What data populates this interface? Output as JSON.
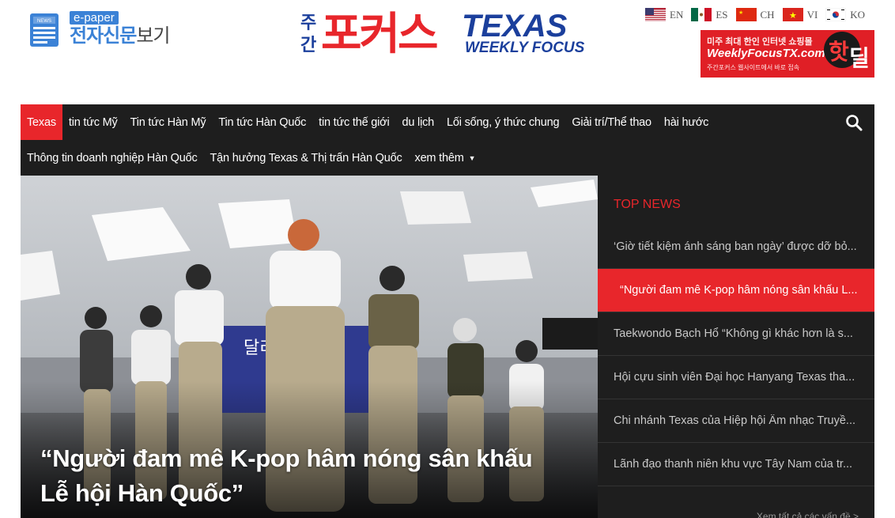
{
  "header": {
    "epaper_tag": "e-paper",
    "epaper_title_bold": "전자신문",
    "epaper_title_thin": "보기",
    "epaper_icon_label": "NEWS",
    "logo": {
      "korean_top": "주",
      "korean_bottom": "간",
      "korean_big": "포커스",
      "english_big": "TEXAS",
      "english_small": "WEEKLY FOCUS"
    },
    "languages": [
      {
        "code": "EN",
        "flag": "us-flag-icon"
      },
      {
        "code": "ES",
        "flag": "mx-flag-icon"
      },
      {
        "code": "CH",
        "flag": "cn-flag-icon"
      },
      {
        "code": "VI",
        "flag": "vn-flag-icon"
      },
      {
        "code": "KO",
        "flag": "kr-flag-icon"
      }
    ],
    "ad": {
      "line1": "미주 최대 한인 인터넷 쇼핑몰",
      "line2": "WeeklyFocusTX.com",
      "line3": "주간포커스 웹사이트에서 바로 접속",
      "badge_red": "핫",
      "badge_white": "딜"
    }
  },
  "nav": {
    "row1": [
      "Texas",
      "tin tức Mỹ",
      "Tin tức Hàn Mỹ",
      "Tin tức Hàn Quốc",
      "tin tức thế giới",
      "du lịch",
      "Lối sống, ý thức chung",
      "Giải trí/Thể thao",
      "hài hước"
    ],
    "row2": [
      "Thông tin doanh nghiệp Hàn Quốc",
      "Tận hưởng Texas & Thị trấn Hàn Quốc",
      "xem thêm"
    ],
    "active": "Texas"
  },
  "hero": {
    "title": "“Người đam mê K-pop hâm nóng sân khấu Lễ hội Hàn Quốc”",
    "banner_text": "달리"
  },
  "top_news": {
    "heading": "TOP NEWS",
    "items": [
      "‘Giờ tiết kiệm ánh sáng ban ngày’ được dỡ bỏ...",
      "“Người đam mê K-pop hâm nóng sân khấu L...",
      "Taekwondo Bạch Hổ “Không gì khác hơn là s...",
      "Hội cựu sinh viên Đại học Hanyang Texas tha...",
      "Chi nhánh Texas của Hiệp hội Âm nhạc Truyề...",
      "Lãnh đạo thanh niên khu vực Tây Nam của tr..."
    ],
    "active_index": 1,
    "see_all": "Xem tất cả các vấn đề >"
  },
  "colors": {
    "accent": "#e8262b",
    "nav_bg": "#1e1e1e",
    "epaper_blue": "#3b82d6",
    "logo_blue": "#1b3f9c"
  }
}
